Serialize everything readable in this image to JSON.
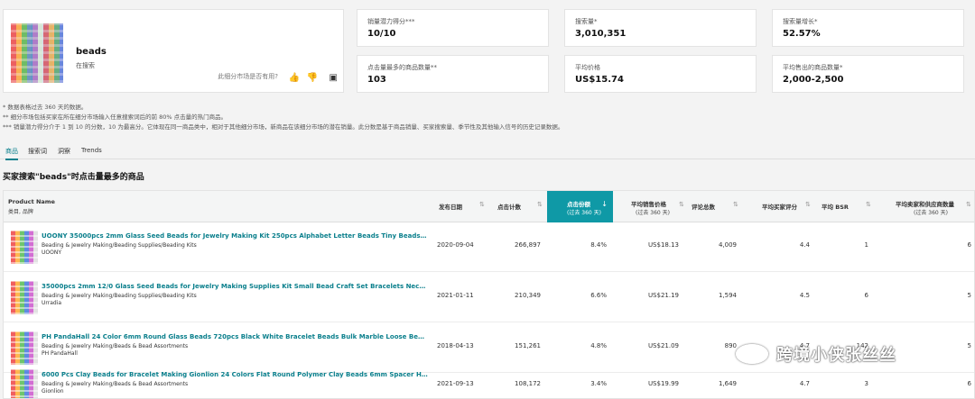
{
  "product": {
    "name": "beads",
    "sub": "在搜索",
    "feedback_text": "此细分市场是否有用?"
  },
  "metrics": [
    {
      "label": "销量潜力得分***",
      "value": "10/10"
    },
    {
      "label": "搜索量*",
      "value": "3,010,351"
    },
    {
      "label": "搜索量增长*",
      "value": "52.57%"
    },
    {
      "label": "点击量最多的商品数量**",
      "value": "103"
    },
    {
      "label": "平均价格",
      "value": "US$15.74"
    },
    {
      "label": "平均售出的商品数量*",
      "value": "2,000-2,500"
    }
  ],
  "notes": [
    "* 数据表格过去 360 天的数据。",
    "** 细分市场包括买家在所在细分市场输入任意搜索词后的前 80% 点击量的热门商品。",
    "*** 销量潜力得分介于 1 到 10 的分数，10 为最高分。它体现在同一商品类中，相对于其他细分市场，新商品在该细分市场的潜在销量。此分数是基于商品销量、买家搜索量、季节性及其他输入信号的历史记录数据。"
  ],
  "tabs": [
    "商品",
    "搜索词",
    "洞察",
    "Trends"
  ],
  "section_title": "买家搜索\"beads\"时点击量最多的商品",
  "columns": {
    "product_name": "Product Name",
    "product_sub": "类目, 品牌",
    "release_date": "发布日期",
    "clicks": "点击计数",
    "click_share": "点击份额",
    "click_share_sub": "(过去 360 天)",
    "avg_price": "平均销售价格",
    "avg_price_sub": "(过去 360 天)",
    "reviews": "评论总数",
    "avg_rating": "平均买家评分",
    "avg_bsr": "平均 BSR",
    "sellers": "平均卖家和供应商数量",
    "sellers_sub": "(过去 360 天)"
  },
  "rows": [
    {
      "title": "UOONY 35000pcs 2mm Glass Seed Beads for Jewelry Making Kit 250pcs Alphabet Letter Beads Tiny Beads Set for Bracelets...",
      "category": "Beading & Jewelry Making/Beading Supplies/Beading Kits",
      "brand": "UOONY",
      "date": "2020-09-04",
      "clicks": "266,897",
      "share": "8.4%",
      "price": "US$18.13",
      "reviews": "4,009",
      "rating": "4.4",
      "bsr": "1",
      "sellers": "6"
    },
    {
      "title": "35000pcs 2mm 12/0 Glass Seed Beads for Jewelry Making Supplies Kit Small Bead Craft Set Bracelets Necklace Ring Makin...",
      "category": "Beading & Jewelry Making/Beading Supplies/Beading Kits",
      "brand": "Urradia",
      "date": "2021-01-11",
      "clicks": "210,349",
      "share": "6.6%",
      "price": "US$21.19",
      "reviews": "1,594",
      "rating": "4.5",
      "bsr": "6",
      "sellers": "5"
    },
    {
      "title": "PH PandaHall 24 Color 6mm Round Glass Beads 720pcs Black White Bracelet Beads Bulk Marble Loose Beads Spacers for Br...",
      "category": "Beading & Jewelry Making/Beads & Bead Assortments",
      "brand": "PH PandaHall",
      "date": "2018-04-13",
      "clicks": "151,261",
      "share": "4.8%",
      "price": "US$21.09",
      "reviews": "890",
      "rating": "4.7",
      "bsr": "142",
      "sellers": "5"
    },
    {
      "title": "6000 Pcs Clay Beads for Bracelet Making Gionlion 24 Colors Flat Round Polymer Clay Beads 6mm Spacer Heishi Beads with ...",
      "category": "Beading & Jewelry Making/Beads & Bead Assortments",
      "brand": "Gionlion",
      "date": "2021-09-13",
      "clicks": "108,172",
      "share": "3.4%",
      "price": "US$19.99",
      "reviews": "1,649",
      "rating": "4.7",
      "bsr": "3",
      "sellers": "6"
    }
  ],
  "watermark": "跨境小侠张丝丝"
}
